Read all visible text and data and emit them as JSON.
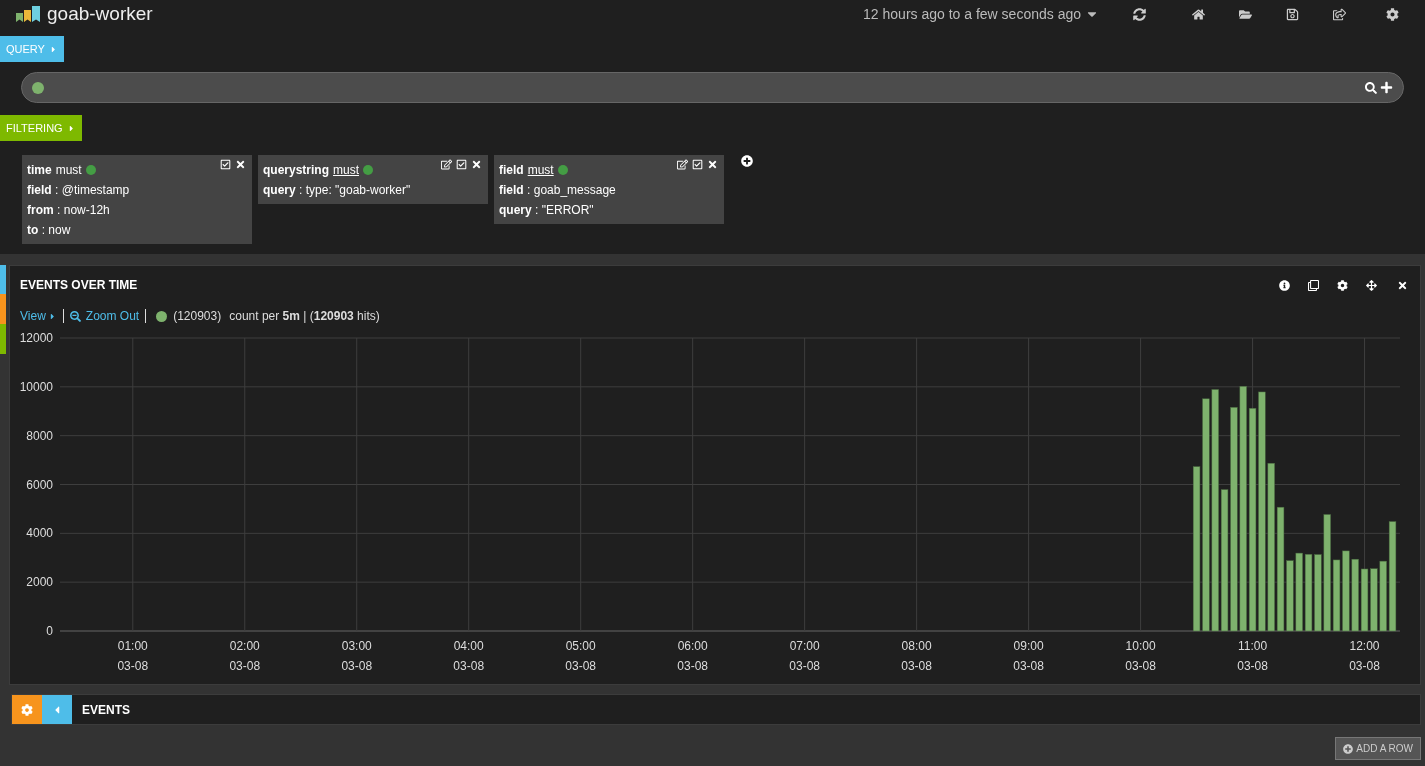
{
  "dashboard": {
    "title": "goab-worker",
    "timespan": "12 hours ago to a few seconds ago"
  },
  "query": {
    "label": "QUERY"
  },
  "filtering": {
    "label": "FILTERING",
    "separator": ":",
    "filters": [
      {
        "type": "time",
        "mode": "must",
        "editable": false,
        "active": true,
        "rows": [
          {
            "key": "field",
            "value": "@timestamp"
          },
          {
            "key": "from",
            "value": "now-12h"
          },
          {
            "key": "to",
            "value": "now"
          }
        ]
      },
      {
        "type": "querystring",
        "mode": "must",
        "editable": true,
        "active": true,
        "rows": [
          {
            "key": "query",
            "value": "type: \"goab-worker\""
          }
        ]
      },
      {
        "type": "field",
        "mode": "must",
        "editable": true,
        "active": true,
        "rows": [
          {
            "key": "field",
            "value": "goab_message"
          },
          {
            "key": "query",
            "value": "\"ERROR\""
          }
        ]
      }
    ]
  },
  "histogram": {
    "title": "EVENTS OVER TIME",
    "view": "View",
    "zoom_out": "Zoom Out",
    "summary": "count per **5m** | (**120903** hits)",
    "chart_data": {
      "type": "bar",
      "x": [
        630,
        635,
        640,
        645,
        650,
        655,
        660,
        665,
        670,
        675,
        680,
        685,
        690,
        695,
        700,
        705,
        710,
        715,
        720,
        725,
        730,
        735
      ],
      "series": [
        {
          "name": "(120903)",
          "color": "#7eb26d",
          "values": [
            6730,
            9510,
            9890,
            5790,
            9160,
            10020,
            9120,
            9790,
            6870,
            5070,
            2880,
            3190,
            3140,
            3130,
            4770,
            2910,
            3280,
            2940,
            2540,
            2550,
            2860,
            4480
          ]
        }
      ],
      "xlim": [
        21,
        739
      ],
      "grid": true,
      "ylim": [
        0,
        12000
      ],
      "yticks": [
        0,
        2000,
        4000,
        6000,
        8000,
        10000,
        12000
      ],
      "xticks": [
        {
          "value": 60,
          "label": "01:00"
        },
        {
          "value": 120,
          "label": "02:00"
        },
        {
          "value": 180,
          "label": "03:00"
        },
        {
          "value": 240,
          "label": "04:00"
        },
        {
          "value": 300,
          "label": "05:00"
        },
        {
          "value": 360,
          "label": "06:00"
        },
        {
          "value": 420,
          "label": "07:00"
        },
        {
          "value": 480,
          "label": "08:00"
        },
        {
          "value": 540,
          "label": "09:00"
        },
        {
          "value": 600,
          "label": "10:00"
        },
        {
          "value": 660,
          "label": "11:00"
        },
        {
          "value": 720,
          "label": "12:00"
        }
      ]
    },
    "axis_dates": [
      "03-08",
      "03-08",
      "03-08",
      "03-08",
      "03-08",
      "03-08",
      "03-08",
      "03-08",
      "03-08",
      "03-08",
      "03-08",
      "03-08"
    ]
  },
  "events_row": {
    "title": "EVENTS"
  },
  "add_row": "ADD A ROW"
}
